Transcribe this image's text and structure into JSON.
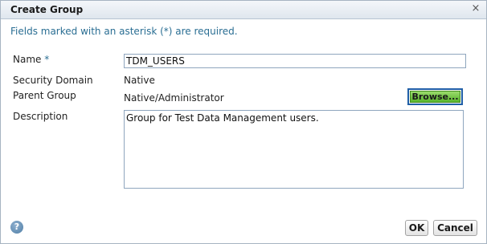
{
  "dialog": {
    "title": "Create Group",
    "close_glyph": "×",
    "required_note": "Fields marked with an asterisk (*) are required."
  },
  "fields": {
    "name_label": "Name",
    "required_marker": "*",
    "name_value": "TDM_USERS",
    "security_domain_label": "Security Domain",
    "security_domain_value": "Native",
    "parent_group_label": "Parent Group",
    "parent_group_value": "Native/Administrator",
    "browse_label": "Browse...",
    "description_label": "Description",
    "description_value": "Group for Test Data Management users."
  },
  "footer": {
    "help_glyph": "?",
    "ok_label": "OK",
    "cancel_label": "Cancel"
  },
  "colors": {
    "accent_text": "#2a6e93",
    "browse_green": "#58b52c",
    "focus_border": "#1f5ea6"
  },
  "icons": {
    "close": "close-icon",
    "help": "help-icon"
  }
}
